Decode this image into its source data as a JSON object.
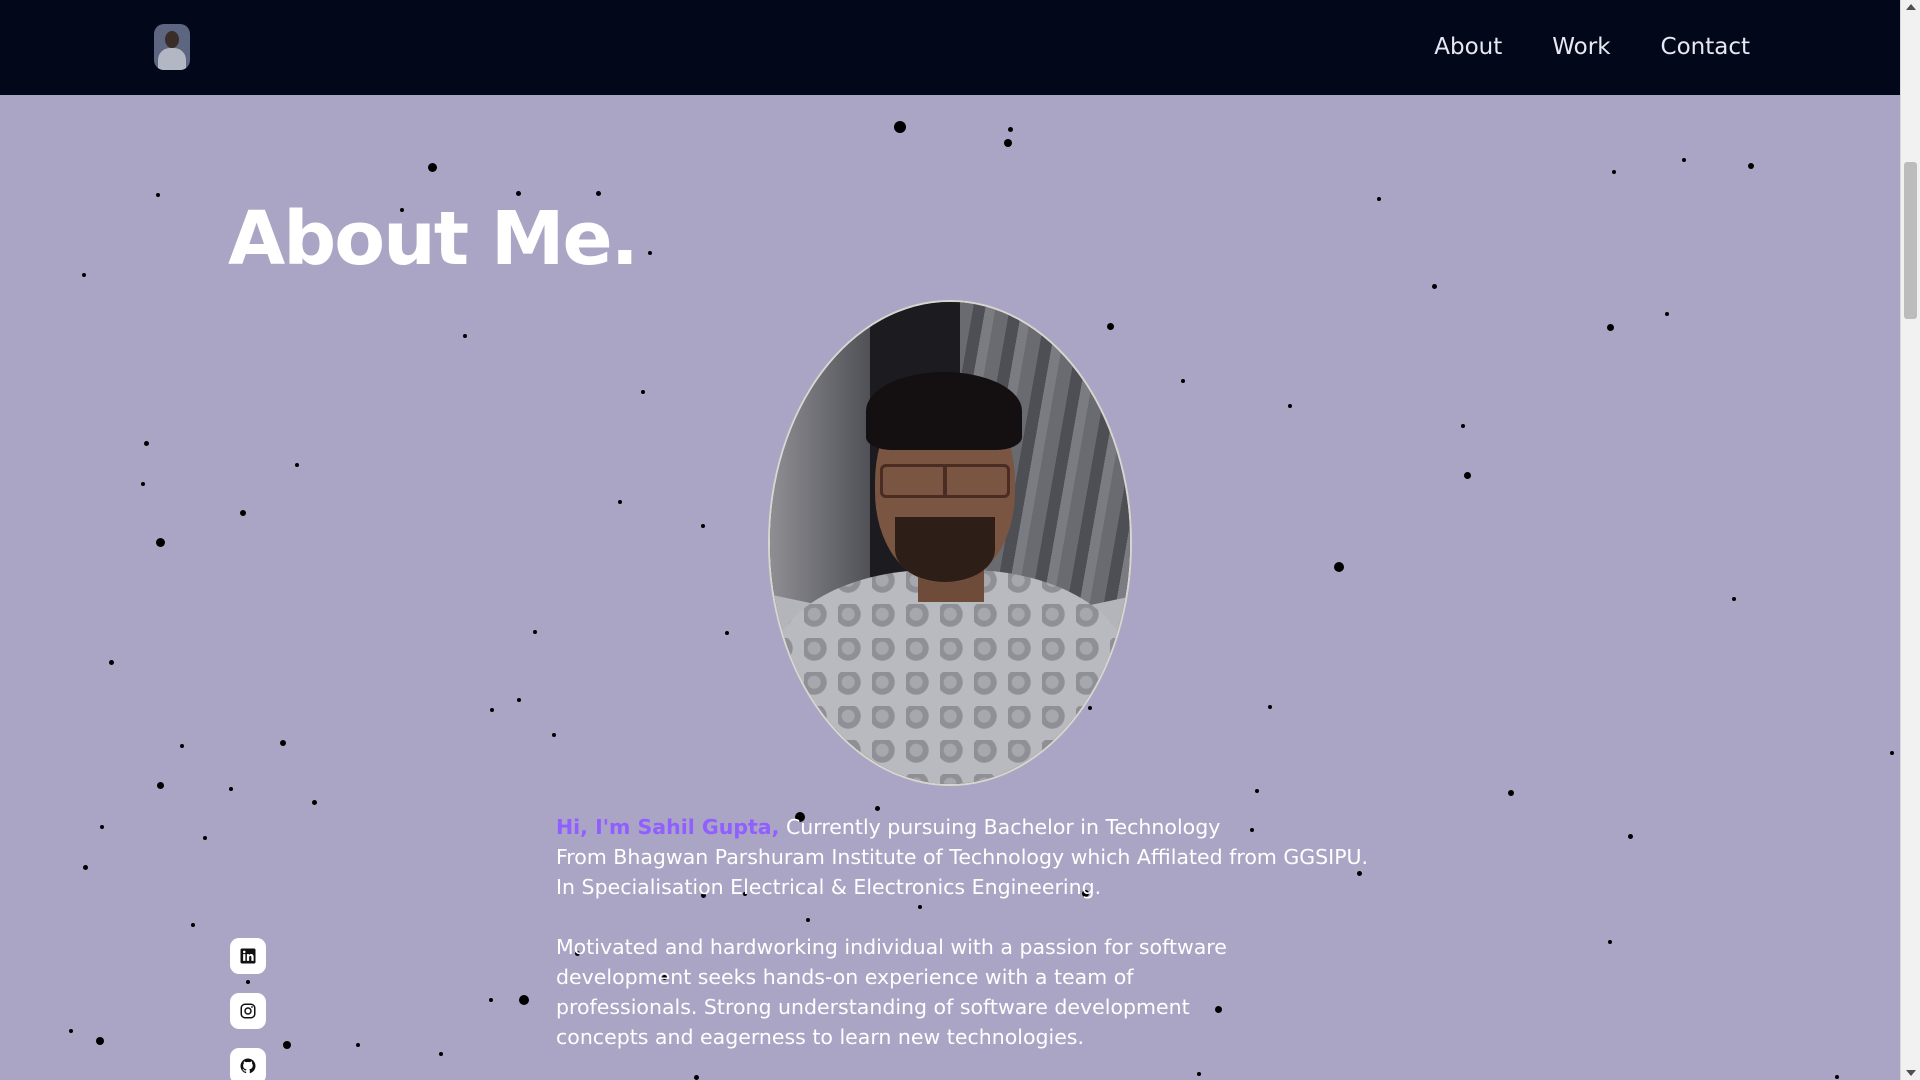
{
  "nav": {
    "links": [
      "About",
      "Work",
      "Contact"
    ]
  },
  "about": {
    "title": "About Me.",
    "greeting": "Hi, I'm Sahil Gupta,",
    "line1_rest": "Currently pursuing Bachelor in Technology",
    "line2": "From Bhagwan Parshuram Institute of Technology which Affilated from GGSIPU.",
    "line3": "In Specialisation Electrical & Electronics Engineering.",
    "paragraph2": "Motivated and hardworking individual with a passion for software development seeks hands-on experience with a team of professionals. Strong understanding of software development concepts and eagerness to learn new technologies."
  },
  "socials": [
    "linkedin-icon",
    "instagram-icon",
    "github-icon"
  ],
  "colors": {
    "background": "#aaa5c4",
    "navbar": "#03071a",
    "accent": "#915eff",
    "text": "#ffffff"
  }
}
